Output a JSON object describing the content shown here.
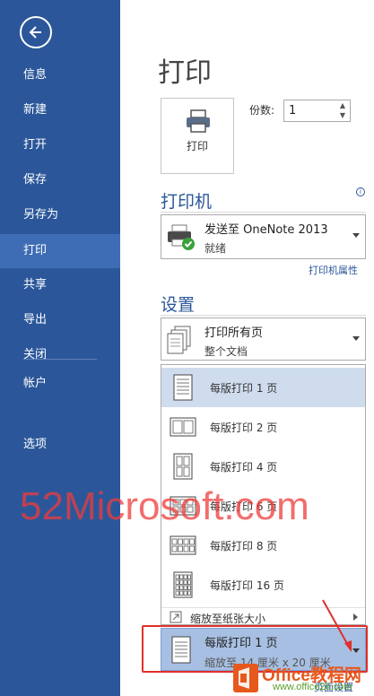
{
  "sidebar": {
    "items": [
      {
        "label": "信息"
      },
      {
        "label": "新建"
      },
      {
        "label": "打开"
      },
      {
        "label": "保存"
      },
      {
        "label": "另存为"
      },
      {
        "label": "打印"
      },
      {
        "label": "共享"
      },
      {
        "label": "导出"
      },
      {
        "label": "关闭"
      },
      {
        "label": "帐户"
      },
      {
        "label": "选项"
      }
    ],
    "active_label": "打印"
  },
  "main": {
    "title": "打印",
    "print_button_label": "打印",
    "copies_label": "份数:",
    "copies_value": "1"
  },
  "printer": {
    "section_title": "打印机",
    "name": "发送至 OneNote 2013",
    "status": "就绪",
    "properties_link": "打印机属性"
  },
  "settings": {
    "section_title": "设置",
    "pages_main": "打印所有页",
    "pages_sub": "整个文档"
  },
  "pages_per_sheet_menu": {
    "items": [
      {
        "label": "每版打印 1 页"
      },
      {
        "label": "每版打印 2 页"
      },
      {
        "label": "每版打印 4 页"
      },
      {
        "label": "每版打印 6 页"
      },
      {
        "label": "每版打印 8 页"
      },
      {
        "label": "每版打印 16 页"
      }
    ],
    "scale_label": "缩放至纸张大小"
  },
  "selected_option": {
    "main": "每版打印 1 页",
    "sub": "缩放至 14 厘米 x 20 厘米"
  },
  "page_setup_link": "页面设置",
  "watermark": {
    "text": "52Microsoft.com",
    "badge_title": "Office教程网",
    "badge_sub": "www.office26.com"
  },
  "colors": {
    "sidebar": "#2b579a",
    "sidebar_active": "#3e6db5",
    "accent": "#2b579a",
    "selection": "#cfdcee",
    "highlight_frame": "#e0302a"
  }
}
